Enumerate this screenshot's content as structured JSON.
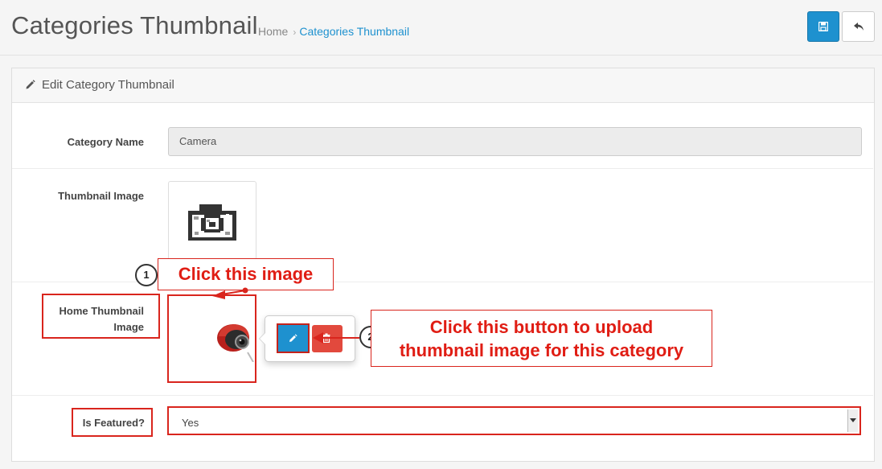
{
  "header": {
    "title": "Categories Thumbnail",
    "breadcrumb": [
      {
        "label": "Home"
      },
      {
        "label": "Categories Thumbnail"
      }
    ],
    "save_icon": "save-icon",
    "back_icon": "reply-icon"
  },
  "panel": {
    "heading": "Edit Category Thumbnail",
    "heading_icon": "pencil-icon"
  },
  "form": {
    "category_name_label": "Category Name",
    "category_name_value": "Camera",
    "thumbnail_label": "Thumbnail Image",
    "thumbnail_icon": "camera-icon",
    "home_thumbnail_label_line1": "Home Thumbnail",
    "home_thumbnail_label_line2": "Image",
    "home_thumbnail_image": "helmet-camera-image",
    "edit_icon": "pencil-icon",
    "clear_icon": "trash-icon",
    "featured_label": "Is Featured?",
    "featured_value": "Yes"
  },
  "annotations": {
    "step1_number": "1",
    "step1_text": "Click this image",
    "step2_number": "2",
    "step2_text_line1": "Click this button to upload",
    "step2_text_line2": "thumbnail image for this category",
    "accent_color": "#d9251d"
  },
  "colors": {
    "primary": "#1e91cf",
    "danger": "#e2493d",
    "annotation": "#e01d14"
  }
}
